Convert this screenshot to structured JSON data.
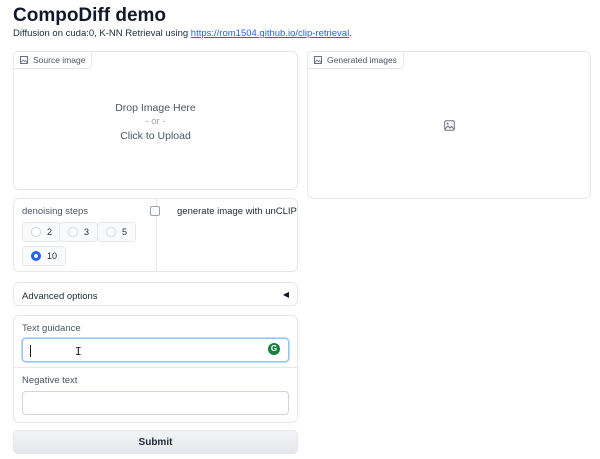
{
  "header": {
    "title": "CompoDiff demo",
    "subtitle_prefix": "Diffusion on cuda:0, K-NN Retrieval using ",
    "subtitle_link": "https://rom1504.github.io/clip-retrieval",
    "subtitle_suffix": "."
  },
  "source_panel": {
    "label": "Source image",
    "drop_text": "Drop Image Here",
    "or_text": "- or -",
    "click_text": "Click to Upload"
  },
  "generated_panel": {
    "label": "Generated images"
  },
  "denoising": {
    "label": "denoising steps",
    "options": [
      "2",
      "3",
      "5",
      "10"
    ],
    "selected": "10"
  },
  "unclip": {
    "label": "generate image with unCLIP",
    "checked": false
  },
  "advanced": {
    "label": "Advanced options",
    "caret": "◀"
  },
  "text_guidance": {
    "label": "Text guidance",
    "value": "",
    "assistant_glyph": "G"
  },
  "negative_text": {
    "label": "Negative text",
    "value": ""
  },
  "submit": {
    "label": "Submit"
  },
  "colors": {
    "accent": "#2563eb",
    "border": "#e5e7eb",
    "assistant": "#15803d"
  }
}
